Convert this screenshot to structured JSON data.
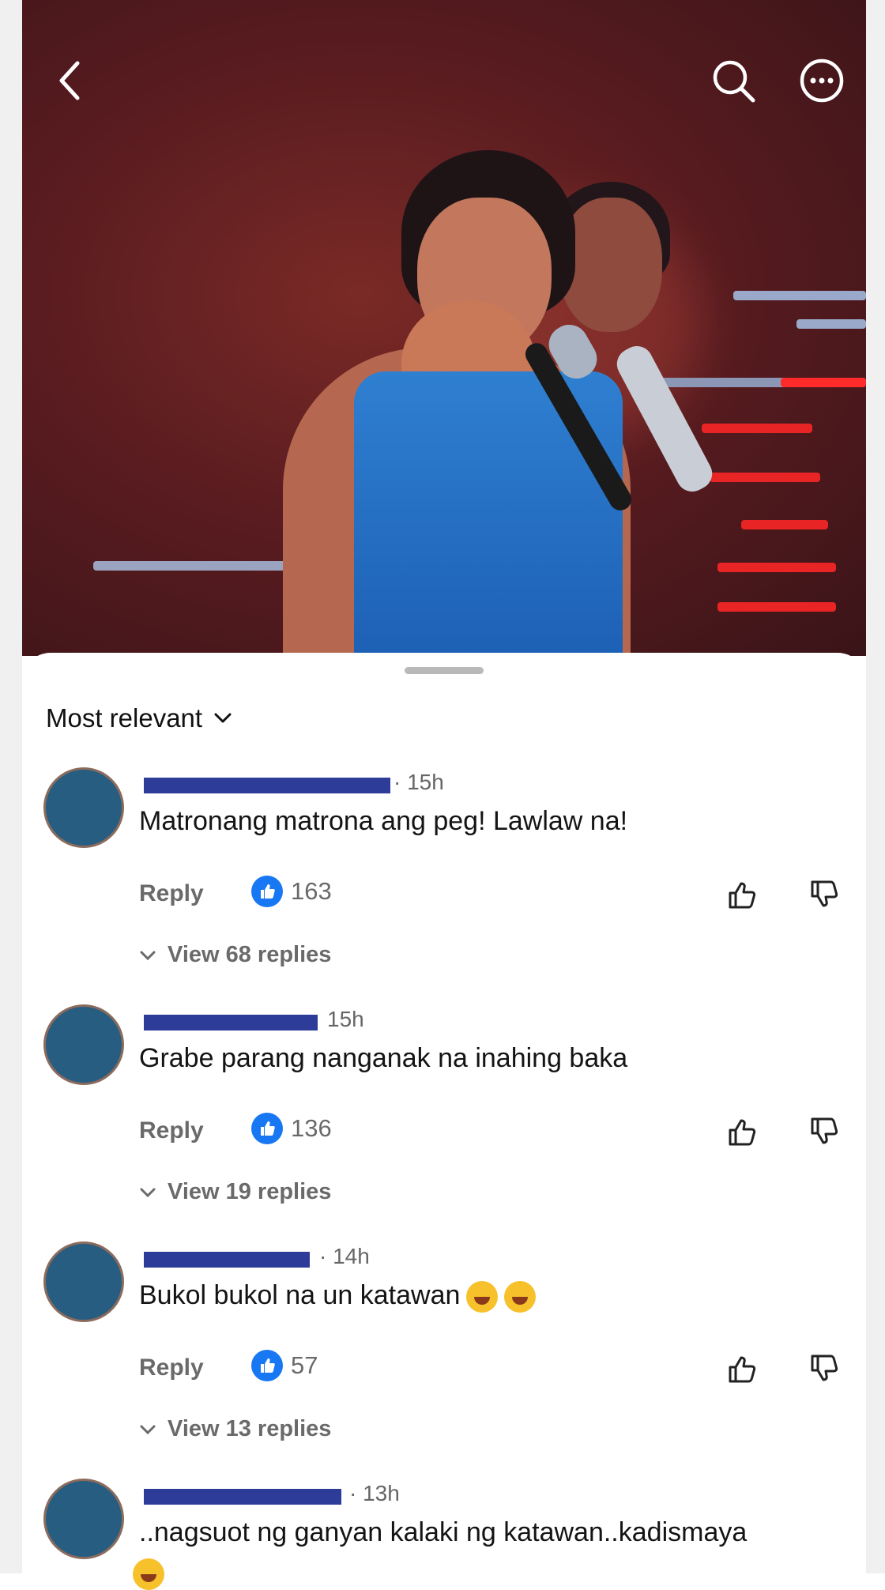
{
  "header": {
    "back_icon": "chevron-left-icon",
    "search_icon": "search-icon",
    "more_icon": "more-horizontal-icon"
  },
  "sort": {
    "label": "Most relevant"
  },
  "colors": {
    "like_badge": "#1877f2",
    "redaction": "#2d3c98",
    "avatar_placeholder": "#285d82"
  },
  "comments": [
    {
      "time": "· 15h",
      "text": "Matronang matrona ang peg! Lawlaw na!",
      "reply_label": "Reply",
      "like_count": "163",
      "view_replies": "View 68 replies"
    },
    {
      "time": "15h",
      "text": "Grabe parang nanganak na inahing baka",
      "reply_label": "Reply",
      "like_count": "136",
      "view_replies": "View 19 replies"
    },
    {
      "time": "· 14h",
      "text": "Bukol bukol na un katawan",
      "reply_label": "Reply",
      "like_count": "57",
      "view_replies": "View 13 replies"
    },
    {
      "time": "· 13h",
      "text": "..nagsuot ng ganyan kalaki ng katawan..kadismaya"
    }
  ]
}
